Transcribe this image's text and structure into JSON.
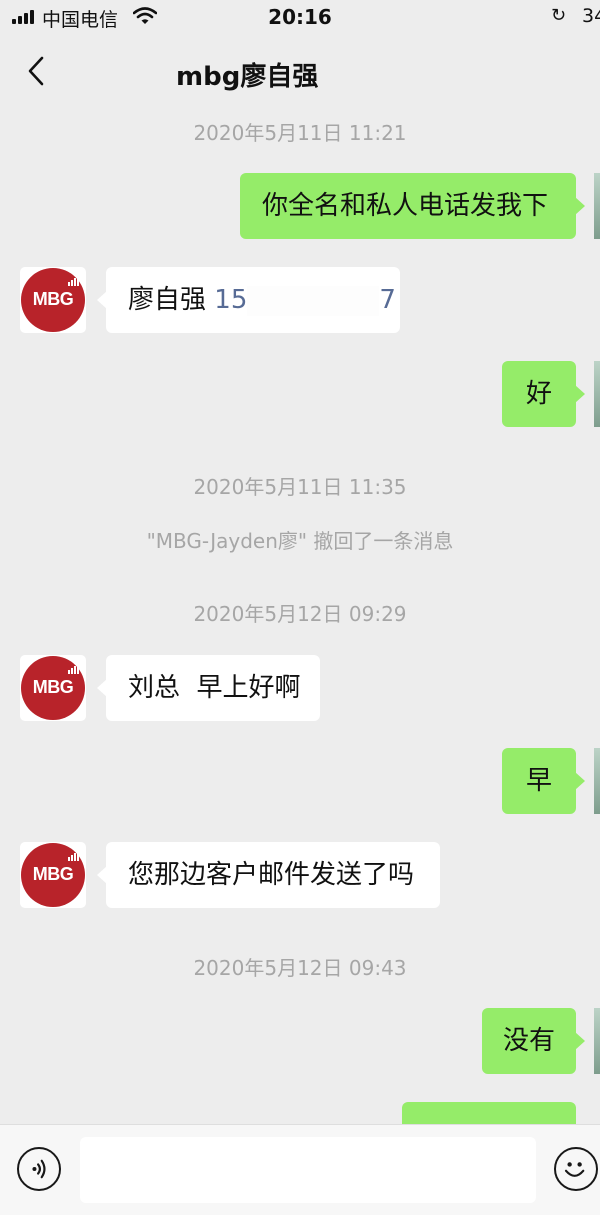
{
  "status_bar": {
    "carrier": "中国电信",
    "time": "20:16",
    "battery": "34"
  },
  "header": {
    "title": "mbg廖自强"
  },
  "messages": [
    {
      "type": "timestamp",
      "text": "2020年5月11日 11:21"
    },
    {
      "type": "outgoing",
      "text": "你全名和私人电话发我下"
    },
    {
      "type": "incoming",
      "sender_avatar": "MBG",
      "name_text": "廖自强",
      "phone_start": "15",
      "phone_end": "7"
    },
    {
      "type": "outgoing",
      "text": "好"
    },
    {
      "type": "timestamp",
      "text": "2020年5月11日 11:35"
    },
    {
      "type": "system",
      "text": "\"MBG-Jayden廖\" 撤回了一条消息"
    },
    {
      "type": "timestamp",
      "text": "2020年5月12日 09:29"
    },
    {
      "type": "incoming",
      "sender_avatar": "MBG",
      "text": "刘总  早上好啊"
    },
    {
      "type": "outgoing",
      "text": "早"
    },
    {
      "type": "incoming",
      "sender_avatar": "MBG",
      "text": "您那边客户邮件发送了吗"
    },
    {
      "type": "timestamp",
      "text": "2020年5月12日 09:43"
    },
    {
      "type": "outgoing",
      "text": "没有"
    }
  ],
  "avatar": {
    "label": "MBG",
    "color": "#b8232a"
  },
  "colors": {
    "outgoing_bubble": "#95ec69",
    "incoming_bubble": "#ffffff",
    "background": "#ededed",
    "link": "#576b95"
  },
  "input_bar": {
    "placeholder": ""
  },
  "icons": [
    "back-chevron-icon",
    "voice-icon",
    "emoji-icon",
    "wifi-icon",
    "signal-icon"
  ]
}
